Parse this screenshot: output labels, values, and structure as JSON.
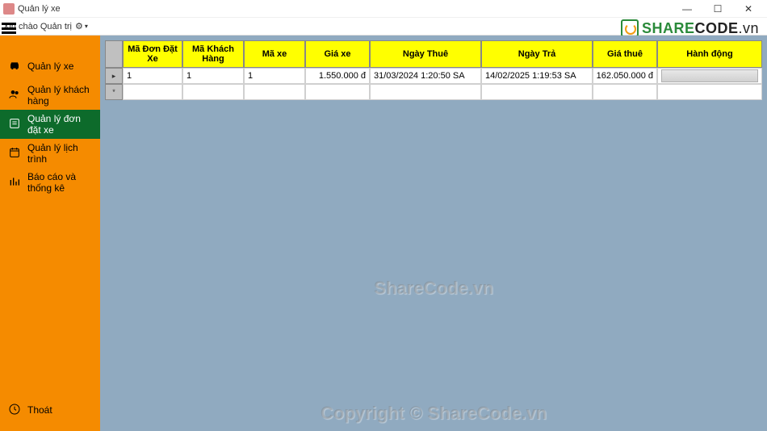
{
  "window": {
    "title": "Quản lý xe",
    "min": "—",
    "max": "☐",
    "close": "✕"
  },
  "menubar": {
    "greeting": "Xin chào Quản trị",
    "gear": "⚙",
    "dropdown": "▾"
  },
  "brand": {
    "share": "SHARE",
    "code": "CODE",
    "vn": ".vn"
  },
  "sidebar": {
    "items": [
      {
        "label": "Quản lý xe"
      },
      {
        "label": "Quản lý khách hàng"
      },
      {
        "label": "Quản lý đơn đặt xe"
      },
      {
        "label": "Quản lý lịch trình"
      },
      {
        "label": "Báo cáo và thống kê"
      }
    ],
    "exit": "Thoát"
  },
  "grid": {
    "headers": [
      "Mã Đơn Đặt Xe",
      "Mã Khách Hàng",
      "Mã xe",
      "Giá xe",
      "Ngày Thuê",
      "Ngày Trả",
      "Giá thuê",
      "Hành động"
    ],
    "rows": [
      {
        "row_marker": "▸",
        "order_id": "1",
        "customer_id": "1",
        "vehicle_id": "1",
        "vehicle_price": "1.550.000 đ",
        "rent_date": "31/03/2024 1:20:50 SA",
        "return_date": "14/02/2025 1:19:53 SA",
        "rent_price": "162.050.000 đ",
        "action": ""
      }
    ],
    "new_row_marker": "*"
  },
  "watermark": {
    "line1": "ShareCode.vn",
    "line2": "Copyright © ShareCode.vn"
  }
}
